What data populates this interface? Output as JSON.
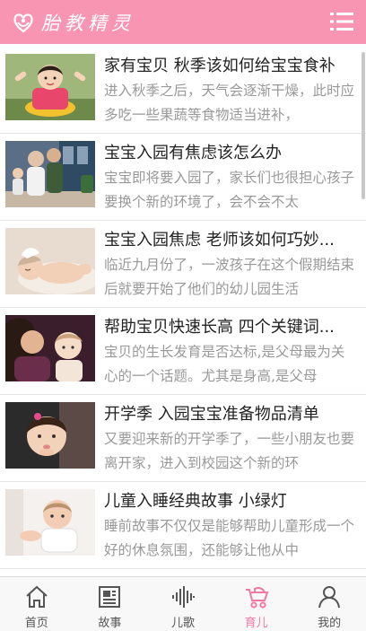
{
  "header": {
    "title": "胎教精灵",
    "logo_icon": "heart-hands-icon",
    "menu_icon": "list-menu-icon",
    "color": "#f795b2"
  },
  "articles": [
    {
      "title": "家有宝贝 秋季该如何给宝宝食补",
      "desc": "进入秋季之后，天气会逐渐干燥，此时应多吃一些果蔬等食物适当进补，"
    },
    {
      "title": "宝宝入园有焦虑该怎么办",
      "desc": "宝宝即将要入园了，家长们也很担心孩子要换个新的环境了，会不会不太"
    },
    {
      "title": "宝宝入园焦虑 老师该如何巧妙...",
      "desc": "临近九月份了，一波孩子在这个假期结束后就要开始了他们的幼儿园生活"
    },
    {
      "title": "帮助宝贝快速长高 四个关键词...",
      "desc": "宝贝的生长发育是否达标,是父母最为关心的一个话题。尤其是身高,是父母"
    },
    {
      "title": "开学季 入园宝宝准备物品清单",
      "desc": "又要迎来新的开学季了，一些小朋友也要离开家，进入到校园这个新的环"
    },
    {
      "title": "儿童入睡经典故事 小绿灯",
      "desc": "睡前故事不仅仅是能够帮助儿童形成一个好的休息氛围，还能够让他从中"
    }
  ],
  "tabs": [
    {
      "label": "首页",
      "icon": "home-icon"
    },
    {
      "label": "故事",
      "icon": "newspaper-icon"
    },
    {
      "label": "儿歌",
      "icon": "sound-wave-icon"
    },
    {
      "label": "育儿",
      "icon": "stroller-icon",
      "active": true
    },
    {
      "label": "我的",
      "icon": "user-icon"
    }
  ],
  "accent_color": "#f27aa0"
}
